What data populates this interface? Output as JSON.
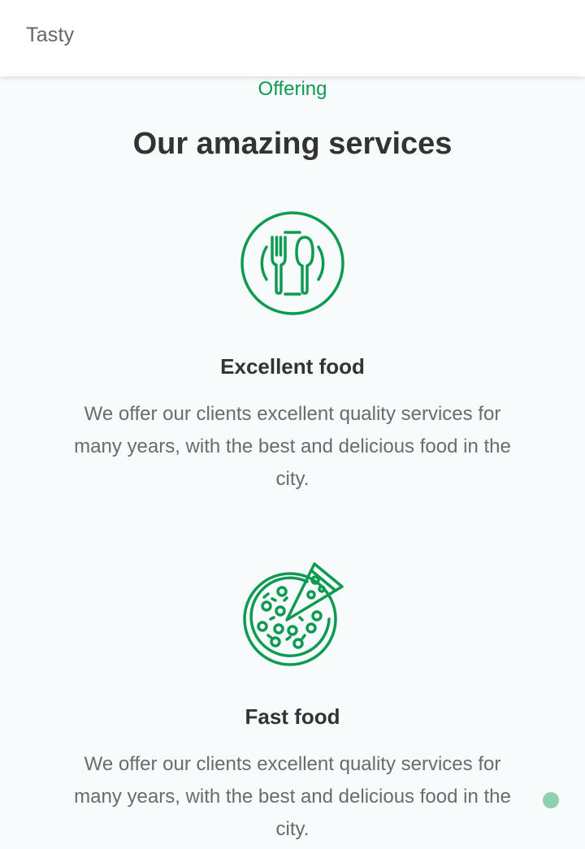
{
  "header": {
    "logo": "Tasty"
  },
  "services": {
    "eyebrow": "Offering",
    "title": "Our amazing services",
    "items": [
      {
        "icon": "cutlery-icon",
        "title": "Excellent food",
        "description": "We offer our clients excellent quality services for many years, with the best and delicious food in the city."
      },
      {
        "icon": "pizza-icon",
        "title": "Fast food",
        "description": "We offer our clients excellent quality services for many years, with the best and delicious food in the city."
      }
    ]
  },
  "colors": {
    "accent": "#0f9a51",
    "heading": "#333333",
    "body_text": "#6b6b6b",
    "background": "#f7fbfb",
    "scroll_indicator": "#8fd1ad"
  }
}
